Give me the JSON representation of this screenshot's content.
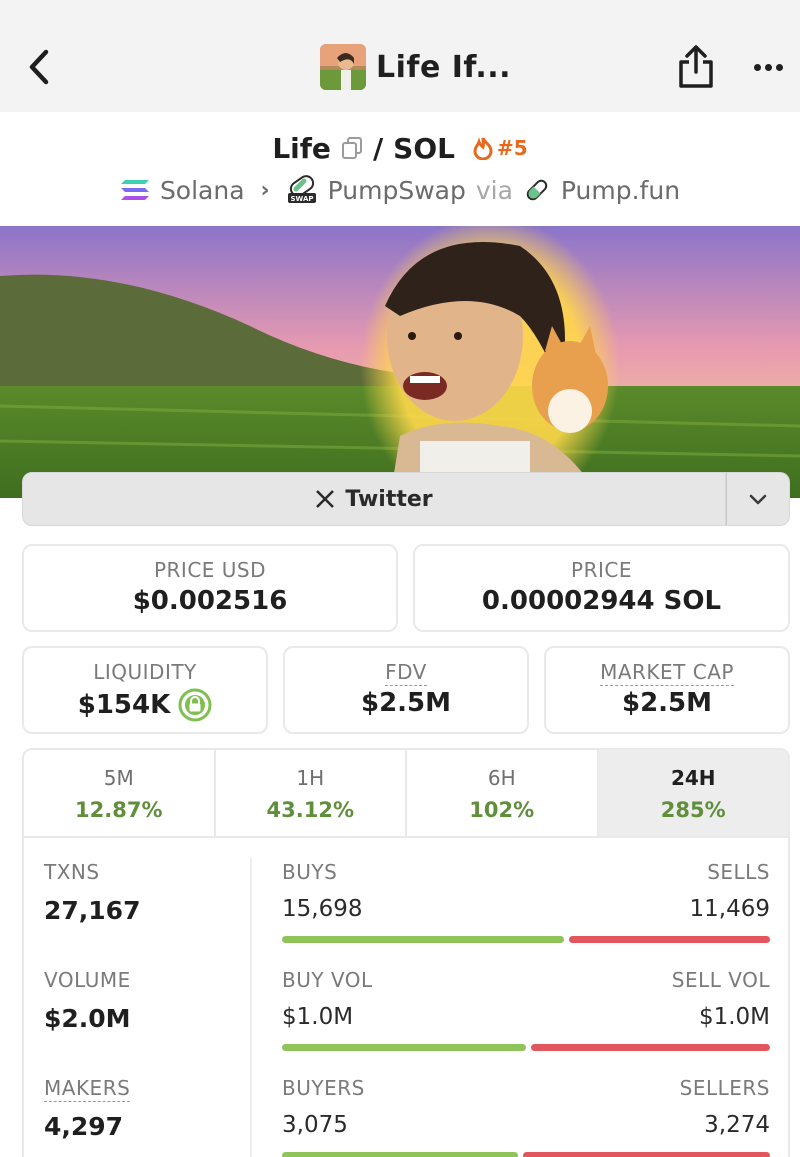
{
  "nav": {
    "title": "Life If...",
    "back_icon": "chevron-left-icon",
    "share_icon": "share-icon",
    "more_icon": "more-horizontal-icon"
  },
  "pair": {
    "base": "Life",
    "separator": "/",
    "quote": "SOL",
    "rank": "#5",
    "chain": "Solana",
    "dex": "PumpSwap",
    "via": "via",
    "launchpad": "Pump.fun"
  },
  "socials": {
    "twitter_label": "Twitter"
  },
  "prices": {
    "price_usd_label": "PRICE USD",
    "price_usd": "$0.002516",
    "price_label": "PRICE",
    "price_native": "0.00002944 SOL",
    "liquidity_label": "LIQUIDITY",
    "liquidity": "$154K",
    "fdv_label": "FDV",
    "fdv": "$2.5M",
    "mcap_label": "MARKET CAP",
    "mcap": "$2.5M"
  },
  "periods": [
    {
      "label": "5M",
      "change": "12.87%"
    },
    {
      "label": "1H",
      "change": "43.12%"
    },
    {
      "label": "6H",
      "change": "102%"
    },
    {
      "label": "24H",
      "change": "285%"
    }
  ],
  "metrics": {
    "txns_label": "TXNS",
    "txns": "27,167",
    "volume_label": "VOLUME",
    "volume": "$2.0M",
    "makers_label": "MAKERS",
    "makers": "4,297",
    "buys_label": "BUYS",
    "buys": "15,698",
    "sells_label": "SELLS",
    "sells": "11,469",
    "buy_vol_label": "BUY VOL",
    "buy_vol": "$1.0M",
    "sell_vol_label": "SELL VOL",
    "sell_vol": "$1.0M",
    "buyers_label": "BUYERS",
    "buyers": "3,075",
    "sellers_label": "SELLERS",
    "sellers": "3,274"
  },
  "ratios": {
    "buys_fraction": 0.578,
    "buy_vol_fraction": 0.5,
    "buyers_fraction": 0.484
  },
  "colors": {
    "positive": "#5f8f3a",
    "buy_bar": "#8fc45a",
    "sell_bar": "#e2565e",
    "rank": "#e8691d"
  }
}
